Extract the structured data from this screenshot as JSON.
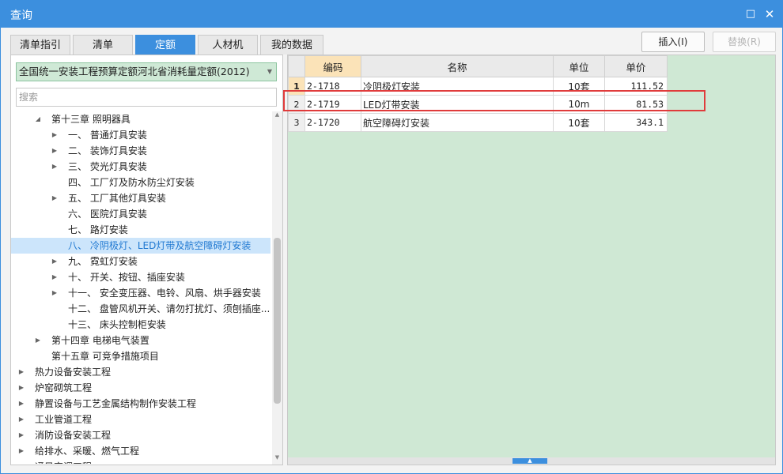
{
  "window": {
    "title": "查询",
    "max_icon": "maximize-icon",
    "close_icon": "close-icon"
  },
  "tabs": [
    {
      "label": "清单指引",
      "active": false
    },
    {
      "label": "清单",
      "active": false
    },
    {
      "label": "定额",
      "active": true
    },
    {
      "label": "人材机",
      "active": false
    },
    {
      "label": "我的数据",
      "active": false
    }
  ],
  "actions": {
    "insert_label": "插入(I)",
    "replace_label": "替换(R)"
  },
  "left": {
    "quota_select": "全国统一安装工程预算定额河北省消耗量定额(2012)",
    "search_placeholder": "搜索",
    "tree": [
      {
        "text": "第十三章 照明器具",
        "expander": "expanded"
      },
      {
        "text": "一、 普通灯具安装",
        "expander": "collapsed"
      },
      {
        "text": "二、 装饰灯具安装",
        "expander": "collapsed"
      },
      {
        "text": "三、 荧光灯具安装",
        "expander": "collapsed"
      },
      {
        "text": "四、 工厂灯及防水防尘灯安装",
        "expander": "none"
      },
      {
        "text": "五、 工厂其他灯具安装",
        "expander": "collapsed"
      },
      {
        "text": "六、 医院灯具安装",
        "expander": "none"
      },
      {
        "text": "七、 路灯安装",
        "expander": "none"
      },
      {
        "text": "八、 冷阴极灯、LED灯带及航空障碍灯安装",
        "expander": "none",
        "selected": true
      },
      {
        "text": "九、 霓虹灯安装",
        "expander": "collapsed"
      },
      {
        "text": "十、 开关、按钮、插座安装",
        "expander": "collapsed"
      },
      {
        "text": "十一、 安全变压器、电铃、风扇、烘手器安装",
        "expander": "collapsed"
      },
      {
        "text": "十二、 盘管风机开关、请勿打扰灯、须刨插座...",
        "expander": "none"
      },
      {
        "text": "十三、 床头控制柜安装",
        "expander": "none"
      },
      {
        "text": "第十四章 电梯电气装置",
        "expander": "collapsed"
      },
      {
        "text": "第十五章 可竞争措施项目",
        "expander": "none"
      },
      {
        "text": "热力设备安装工程",
        "expander": "collapsed"
      },
      {
        "text": "炉窑砌筑工程",
        "expander": "collapsed"
      },
      {
        "text": "静置设备与工艺金属结构制作安装工程",
        "expander": "collapsed"
      },
      {
        "text": "工业管道工程",
        "expander": "collapsed"
      },
      {
        "text": "消防设备安装工程",
        "expander": "collapsed"
      },
      {
        "text": "给排水、采暖、燃气工程",
        "expander": "collapsed"
      },
      {
        "text": "通风空调工程",
        "expander": "collapsed"
      }
    ]
  },
  "grid": {
    "columns": [
      "编码",
      "名称",
      "单位",
      "单价"
    ],
    "rows": [
      {
        "no": "1",
        "code": "2-1718",
        "name": "冷阴极灯安装",
        "unit": "10套",
        "price": "111.52"
      },
      {
        "no": "2",
        "code": "2-1719",
        "name": "LED灯带安装",
        "unit": "10m",
        "price": "81.53"
      },
      {
        "no": "3",
        "code": "2-1720",
        "name": "航空障碍灯安装",
        "unit": "10套",
        "price": "343.1"
      }
    ]
  },
  "colors": {
    "accent": "#3c8fde",
    "grid_background": "#cfe8d4",
    "highlight_box": "#e03b3b",
    "selected_row": "#cce5fb"
  }
}
